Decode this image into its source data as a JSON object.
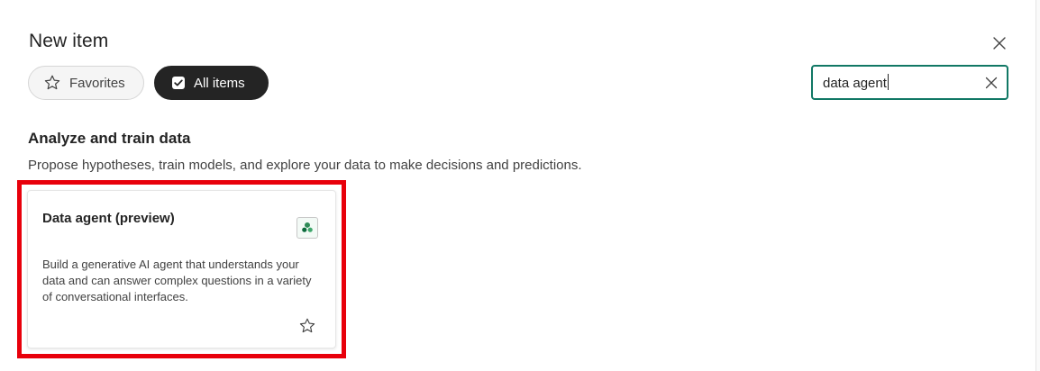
{
  "dialog": {
    "title": "New item",
    "close_icon": "close-icon"
  },
  "filters": {
    "favorites": {
      "label": "Favorites",
      "icon": "star-outline-icon",
      "selected": false
    },
    "all_items": {
      "label": "All items",
      "icon": "checkbox-checked-icon",
      "selected": true
    }
  },
  "search": {
    "value": "data agent",
    "clear_icon": "dismiss-icon",
    "border_color": "#117865"
  },
  "section": {
    "heading": "Analyze and train data",
    "description": "Propose hypotheses, train models, and explore your data to make decisions and predictions."
  },
  "cards": [
    {
      "title": "Data agent (preview)",
      "description": "Build a generative AI agent that understands your data and can answer complex questions in a variety of conversational interfaces.",
      "icon": "data-agent-icon",
      "favorite_icon": "star-outline-icon",
      "highlighted": true,
      "highlight_color": "#e8000b"
    }
  ],
  "colors": {
    "accent_green": "#117865",
    "pill_dark": "#242424",
    "highlight_red": "#e8000b"
  }
}
